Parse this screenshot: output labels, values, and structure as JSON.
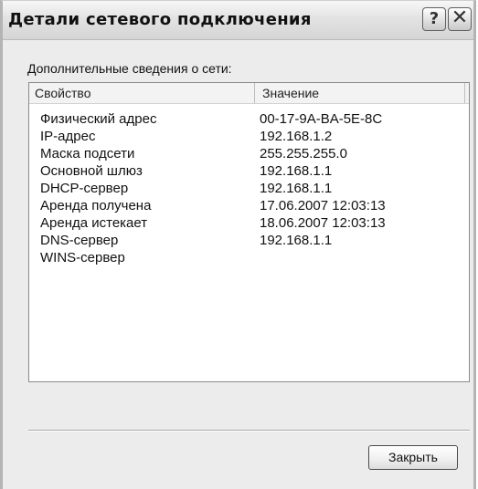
{
  "window": {
    "title": "Детали сетевого подключения",
    "help_label": "?",
    "close_label": "✕"
  },
  "caption": "Дополнительные сведения о сети:",
  "list": {
    "columns": [
      "Свойство",
      "Значение"
    ],
    "rows": [
      {
        "property": "Физический адрес",
        "value": "00-17-9A-BA-5E-8C"
      },
      {
        "property": "IP-адрес",
        "value": "192.168.1.2"
      },
      {
        "property": "Маска подсети",
        "value": "255.255.255.0"
      },
      {
        "property": "Основной шлюз",
        "value": "192.168.1.1"
      },
      {
        "property": "DHCP-сервер",
        "value": "192.168.1.1"
      },
      {
        "property": "Аренда получена",
        "value": "17.06.2007 12:03:13"
      },
      {
        "property": "Аренда истекает",
        "value": "18.06.2007 12:03:13"
      },
      {
        "property": "DNS-сервер",
        "value": "192.168.1.1"
      },
      {
        "property": "WINS-сервер",
        "value": ""
      }
    ]
  },
  "buttons": {
    "close": "Закрыть"
  }
}
